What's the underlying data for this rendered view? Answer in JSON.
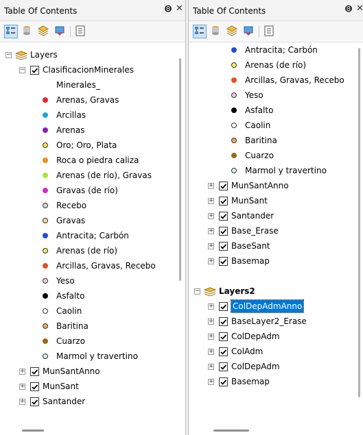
{
  "left_panel": {
    "title": "Table Of Contents",
    "pin_glyph": "➑",
    "close_glyph": "✕",
    "tree": [
      {
        "text": "Layers",
        "kind": "group",
        "expander": "−",
        "level": 0
      },
      {
        "text": "ClasificacionMinerales",
        "kind": "layer",
        "expander": "−",
        "checked": true,
        "level": 1
      },
      {
        "text": "Minerales_",
        "kind": "heading",
        "level": 2
      },
      {
        "text": "Arenas, Gravas",
        "kind": "legend",
        "color": "#e0262b",
        "level": 2
      },
      {
        "text": "Arcillas",
        "kind": "legend",
        "color": "#1fa7d8",
        "level": 2
      },
      {
        "text": "Arenas",
        "kind": "legend",
        "color": "#8a1fb5",
        "level": 2
      },
      {
        "text": "Oro; Oro, Plata",
        "kind": "legend",
        "color": "#f2ea3a",
        "outline": true,
        "level": 2
      },
      {
        "text": "Roca o piedra caliza",
        "kind": "legend",
        "color": "#f28c1e",
        "level": 2
      },
      {
        "text": "Arenas (de río), Gravas",
        "kind": "legend",
        "color": "#a8e63a",
        "level": 2
      },
      {
        "text": "Gravas (de río)",
        "kind": "legend",
        "color": "#d42bc6",
        "level": 2
      },
      {
        "text": "Recebo",
        "kind": "legend",
        "color": "#d8d8d8",
        "outline": true,
        "level": 2
      },
      {
        "text": "Gravas",
        "kind": "legend",
        "color": "#f7d9a0",
        "outline": true,
        "level": 2
      },
      {
        "text": "Antracita; Carbón",
        "kind": "legend",
        "color": "#1e4fd6",
        "level": 2
      },
      {
        "text": "Arenas (de río)",
        "kind": "legend",
        "color": "#f5ef62",
        "outline": true,
        "level": 2
      },
      {
        "text": "Arcillas, Gravas, Recebo",
        "kind": "legend",
        "color": "#e0541e",
        "level": 2
      },
      {
        "text": "Yeso",
        "kind": "legend",
        "color": "#f4c8dc",
        "outline": true,
        "level": 2
      },
      {
        "text": "Asfalto",
        "kind": "legend",
        "color": "#000000",
        "level": 2
      },
      {
        "text": "Caolin",
        "kind": "legend",
        "color": "#ffffff",
        "outline": true,
        "level": 2
      },
      {
        "text": "Baritina",
        "kind": "legend",
        "color": "#f0a85a",
        "outline": true,
        "level": 2
      },
      {
        "text": "Cuarzo",
        "kind": "legend",
        "color": "#9a6a1e",
        "level": 2
      },
      {
        "text": "Marmol y travertino",
        "kind": "legend",
        "color": "#d6f2ea",
        "outline": true,
        "level": 2
      },
      {
        "text": "MunSantAnno",
        "kind": "layer",
        "expander": "+",
        "checked": true,
        "level": 1
      },
      {
        "text": "MunSant",
        "kind": "layer",
        "expander": "+",
        "checked": true,
        "level": 1
      },
      {
        "text": "Santander",
        "kind": "layer",
        "expander": "+",
        "checked": true,
        "level": 1
      }
    ]
  },
  "right_panel": {
    "title": "Table Of Contents",
    "pin_glyph": "➑",
    "close_glyph": "✕",
    "tree": [
      {
        "text": "Antracita; Carbón",
        "kind": "legend",
        "color": "#1e4fd6",
        "level": 2
      },
      {
        "text": "Arenas (de río)",
        "kind": "legend",
        "color": "#f5ef62",
        "outline": true,
        "level": 2
      },
      {
        "text": "Arcillas, Gravas, Recebo",
        "kind": "legend",
        "color": "#e0541e",
        "level": 2
      },
      {
        "text": "Yeso",
        "kind": "legend",
        "color": "#f4c8dc",
        "outline": true,
        "level": 2
      },
      {
        "text": "Asfalto",
        "kind": "legend",
        "color": "#000000",
        "level": 2
      },
      {
        "text": "Caolin",
        "kind": "legend",
        "color": "#ffffff",
        "outline": true,
        "level": 2
      },
      {
        "text": "Baritina",
        "kind": "legend",
        "color": "#f0a85a",
        "outline": true,
        "level": 2
      },
      {
        "text": "Cuarzo",
        "kind": "legend",
        "color": "#9a6a1e",
        "level": 2
      },
      {
        "text": "Marmol y travertino",
        "kind": "legend",
        "color": "#d6f2ea",
        "outline": true,
        "level": 2
      },
      {
        "text": "MunSantAnno",
        "kind": "layer",
        "expander": "+",
        "checked": true,
        "level": 1
      },
      {
        "text": "MunSant",
        "kind": "layer",
        "expander": "+",
        "checked": true,
        "level": 1
      },
      {
        "text": "Santander",
        "kind": "layer",
        "expander": "+",
        "checked": true,
        "level": 1
      },
      {
        "text": "Base_Erase",
        "kind": "layer",
        "expander": "+",
        "checked": true,
        "level": 1
      },
      {
        "text": "BaseSant",
        "kind": "layer",
        "expander": "+",
        "checked": true,
        "level": 1
      },
      {
        "text": "Basemap",
        "kind": "layer",
        "expander": "+",
        "checked": true,
        "level": 1
      },
      {
        "text": "",
        "kind": "spacer",
        "level": 0
      },
      {
        "text": "Layers2",
        "kind": "group",
        "expander": "−",
        "bold": true,
        "level": 0
      },
      {
        "text": "ColDepAdmAnno",
        "kind": "layer",
        "expander": "+",
        "checked": true,
        "selected": true,
        "level": 1
      },
      {
        "text": "BaseLayer2_Erase",
        "kind": "layer",
        "expander": "+",
        "checked": true,
        "level": 1
      },
      {
        "text": "ColDepAdm",
        "kind": "layer",
        "expander": "+",
        "checked": true,
        "level": 1
      },
      {
        "text": "ColAdm",
        "kind": "layer",
        "expander": "+",
        "checked": true,
        "level": 1
      },
      {
        "text": "ColDepAdm",
        "kind": "layer",
        "expander": "+",
        "checked": true,
        "level": 1
      },
      {
        "text": "Basemap",
        "kind": "layer",
        "expander": "+",
        "checked": true,
        "level": 1
      }
    ]
  },
  "toolbar_icons": [
    "list-by-drawing-order-icon",
    "list-by-source-icon",
    "list-by-visibility-icon",
    "list-by-selection-icon",
    "options-icon"
  ],
  "colors": {
    "selection": "#0078d7",
    "active_button": "#cfe5f7",
    "group_icon": "#f2c230"
  }
}
